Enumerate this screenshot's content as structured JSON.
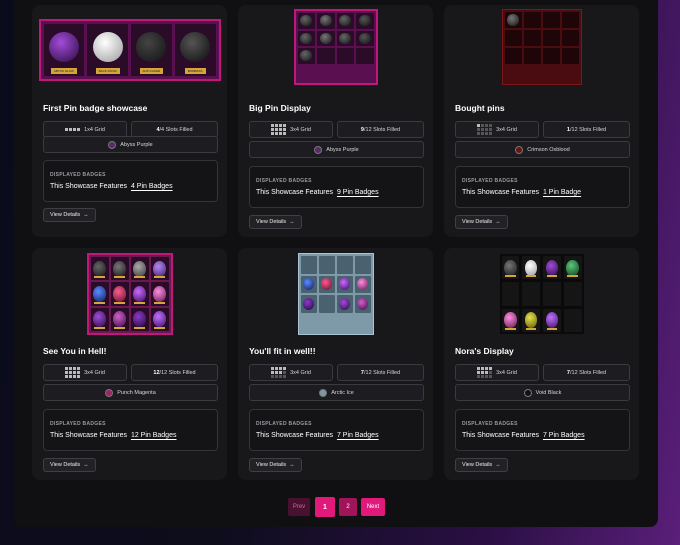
{
  "cards": [
    {
      "title": "First Pin badge showcase",
      "grid": "1x4 Grid",
      "filled": "4",
      "total": "/4 Slots Filled",
      "theme": "Abyss Purple",
      "theme_color": "#5a2a6a",
      "count": "4 Pin Badges",
      "features_prefix": "This Showcase Features",
      "displayed_label": "DISPLAYED BADGES",
      "button": "View Details"
    },
    {
      "title": "Big Pin Display",
      "grid": "3x4 Grid",
      "filled": "9",
      "total": "/12 Slots Filled",
      "theme": "Abyss Purple",
      "theme_color": "#5a2a6a",
      "count": "9 Pin Badges",
      "features_prefix": "This Showcase Features",
      "displayed_label": "DISPLAYED BADGES",
      "button": "View Details"
    },
    {
      "title": "Bought pins",
      "grid": "3x4 Grid",
      "filled": "1",
      "total": "/12 Slots Filled",
      "theme": "Crimson Oxblood",
      "theme_color": "#6a1414",
      "count": "1 Pin Badge",
      "features_prefix": "This Showcase Features",
      "displayed_label": "DISPLAYED BADGES",
      "button": "View Details"
    },
    {
      "title": "See You in Hell!",
      "grid": "3x4 Grid",
      "filled": "12",
      "total": "/12 Slots Filled",
      "theme": "Punch Magenta",
      "theme_color": "#a0206a",
      "count": "12 Pin Badges",
      "features_prefix": "This Showcase Features",
      "displayed_label": "DISPLAYED BADGES",
      "button": "View Details"
    },
    {
      "title": "You'll fit in well!!",
      "grid": "3x4 Grid",
      "filled": "7",
      "total": "/12 Slots Filled",
      "theme": "Arctic Ice",
      "theme_color": "#7a9aa8",
      "count": "7 Pin Badges",
      "features_prefix": "This Showcase Features",
      "displayed_label": "DISPLAYED BADGES",
      "button": "View Details"
    },
    {
      "title": "Nora's Display",
      "grid": "3x4 Grid",
      "filled": "7",
      "total": "/12 Slots Filled",
      "theme": "Void Black",
      "theme_color": "#111111",
      "count": "7 Pin Badges",
      "features_prefix": "This Showcase Features",
      "displayed_label": "DISPLAYED BADGES",
      "button": "View Details"
    }
  ],
  "card1_pins": [
    "ABYSS GLOW",
    "BACK DOOR",
    "ANTI-FAKER",
    "BOMBASS"
  ],
  "pagination": {
    "prev": "Prev",
    "page1": "1",
    "page2": "2",
    "next": "Next"
  },
  "colors": {
    "accent": "#e0197a",
    "abyss": "#5a1050",
    "crimson": "#4a0c10",
    "magenta": "#6a1850",
    "arctic": "#7e9aa8"
  }
}
